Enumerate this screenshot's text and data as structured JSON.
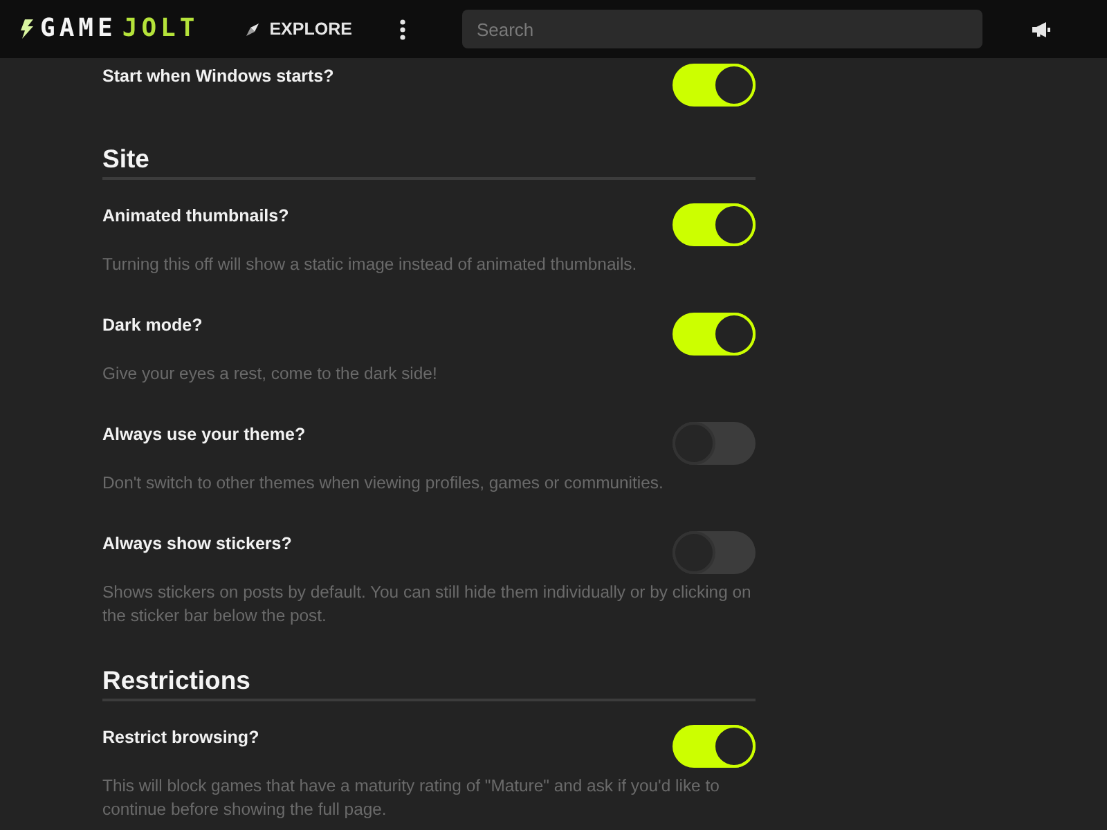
{
  "header": {
    "logo": {
      "text": "GAME",
      "accent": "JOLT"
    },
    "nav": [
      {
        "label": "EXPLORE"
      }
    ],
    "search": {
      "placeholder": "Search"
    }
  },
  "settings": [
    {
      "label": "Start when Windows starts?",
      "on": true
    }
  ],
  "sections": [
    {
      "title": "Site",
      "settings": [
        {
          "label": "Animated thumbnails?",
          "description": "Turning this off will show a static image instead of animated thumbnails.",
          "on": true
        },
        {
          "label": "Dark mode?",
          "description": "Give your eyes a rest, come to the dark side!",
          "on": true
        },
        {
          "label": "Always use your theme?",
          "description": "Don't switch to other themes when viewing profiles, games or communities.",
          "on": false
        },
        {
          "label": "Always show stickers?",
          "description": "Shows stickers on posts by default. You can still hide them individually or by clicking on the sticker bar below the post.",
          "on": false
        }
      ]
    },
    {
      "title": "Restrictions",
      "settings": [
        {
          "label": "Restrict browsing?",
          "description": "This will block games that have a maturity rating of \"Mature\" and ask if you'd like to continue before showing the full page.",
          "on": true
        }
      ]
    }
  ]
}
